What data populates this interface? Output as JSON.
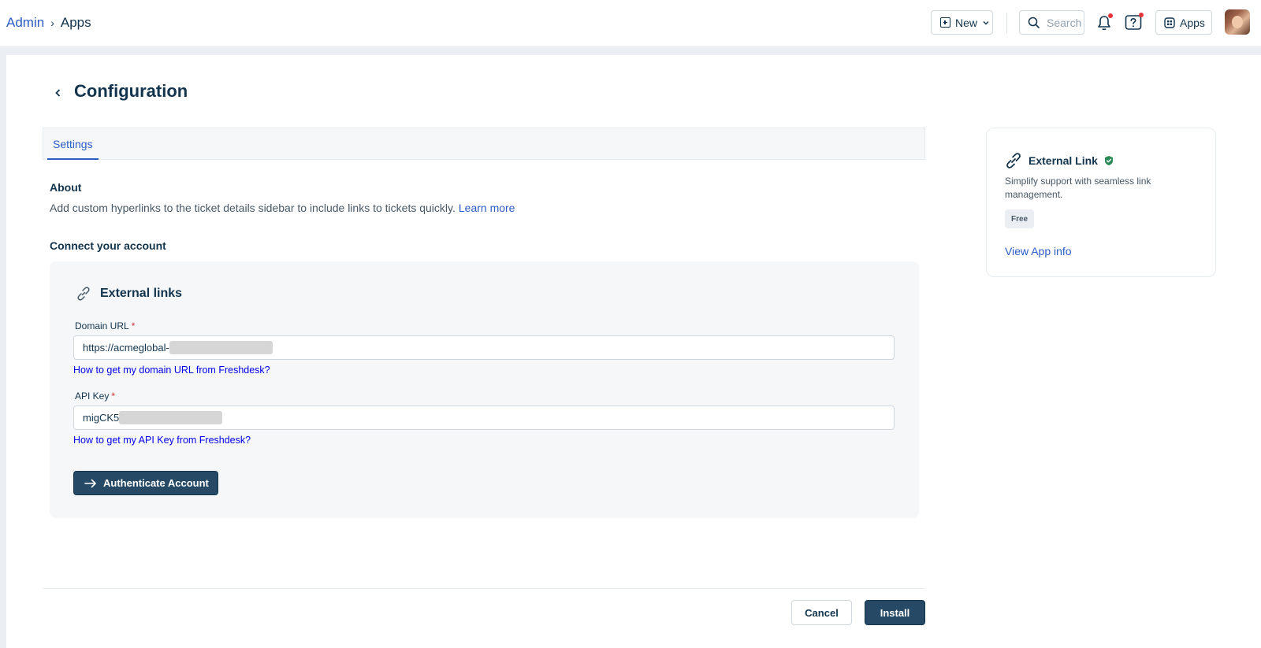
{
  "breadcrumb": {
    "parent": "Admin",
    "separator": "›",
    "current": "Apps"
  },
  "topbar": {
    "new_label": "New",
    "search_placeholder": "Search",
    "apps_label": "Apps"
  },
  "page": {
    "title": "Configuration"
  },
  "tabs": [
    {
      "label": "Settings",
      "active": true
    }
  ],
  "about": {
    "heading": "About",
    "text": "Add custom hyperlinks to the ticket details sidebar to include links to tickets quickly.",
    "learn_more": "Learn more"
  },
  "connect": {
    "heading": "Connect your account",
    "panel_title": "External links",
    "domain": {
      "label": "Domain URL",
      "required_mark": "*",
      "value": "https://acmeglobal-",
      "help": "How to get my domain URL from Freshdesk?"
    },
    "api_key": {
      "label": "API Key",
      "required_mark": "*",
      "value": "migCK5",
      "help": "How to get my API Key from Freshdesk?"
    },
    "auth_button": "Authenticate Account"
  },
  "footer": {
    "cancel": "Cancel",
    "install": "Install"
  },
  "app_card": {
    "name": "External Link",
    "description": "Simplify support with seamless link management.",
    "badge": "Free",
    "view_link": "View App info"
  },
  "colors": {
    "link": "#2c5cc5",
    "primary_button": "#264966",
    "verified": "#2b8a57",
    "notification_dot": "#e43538"
  },
  "icons": {
    "back": "chevron-left-icon",
    "bell": "bell-icon",
    "help": "question-icon",
    "link": "link-icon",
    "verified": "verified-shield-icon"
  }
}
